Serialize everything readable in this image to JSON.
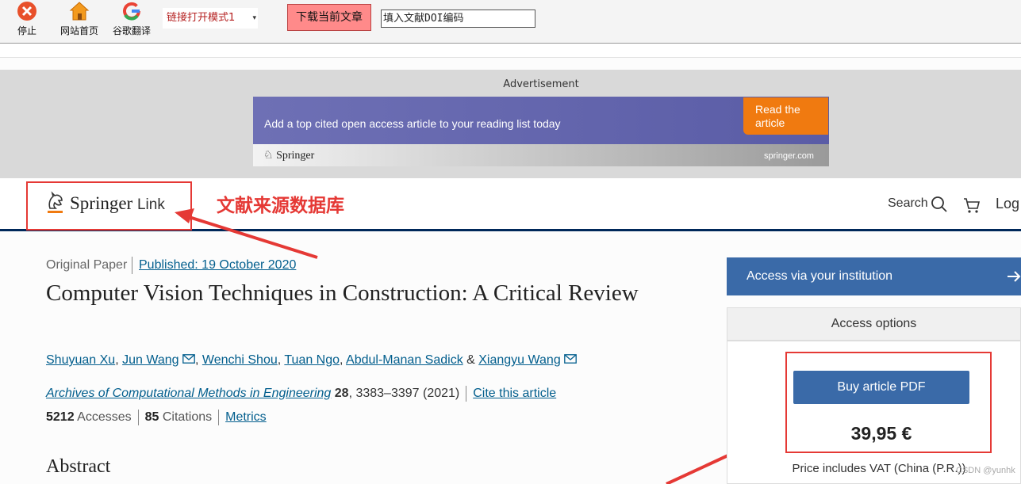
{
  "toolbar": {
    "stop_label": "停止",
    "home_label": "网站首页",
    "translate_label": "谷歌翻译",
    "mode_select_value": "链接打开模式1",
    "download_label": "下载当前文章",
    "doi_placeholder": "填入文献DOI编码"
  },
  "ad": {
    "label": "Advertisement",
    "headline": "Add a top cited open access article to your reading list today",
    "cta": "Read the article",
    "brand": "Springer",
    "url": "springer.com"
  },
  "header": {
    "logo_springer": "Springer",
    "logo_link": "Link",
    "search_label": "Search",
    "login_label": "Log"
  },
  "annotation": {
    "source_label": "文献来源数据库"
  },
  "article": {
    "type": "Original Paper",
    "published": "Published: 19 October 2020",
    "title": "Computer Vision Techniques in Construction: A Critical Review",
    "authors": [
      "Shuyuan Xu",
      "Jun Wang",
      "Wenchi Shou",
      "Tuan Ngo",
      "Abdul-Manan Sadick",
      "Xiangyu Wang"
    ],
    "author_sep_comma": ", ",
    "author_sep_amp": " & ",
    "journal": "Archives of Computational Methods in Engineering",
    "volume": "28",
    "pages_year": ", 3383–3397 (2021)",
    "cite_label": "Cite this article",
    "accesses_value": "5212",
    "accesses_label": "Accesses",
    "citations_value": "85",
    "citations_label": "Citations",
    "metrics_label": "Metrics",
    "abstract_heading": "Abstract"
  },
  "sidebar": {
    "institution_label": "Access via your institution",
    "access_options_label": "Access options",
    "buy_label": "Buy article PDF",
    "price": "39,95 €",
    "vat_note": "Price includes VAT (China (P.R.))"
  },
  "watermark": "CSDN @yunhk"
}
